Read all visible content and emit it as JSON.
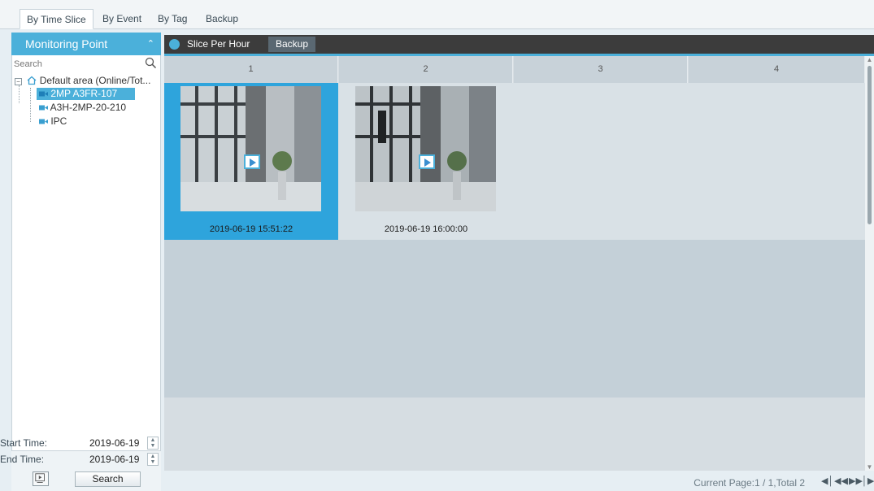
{
  "tabs": [
    {
      "label": "By Time Slice",
      "active": true
    },
    {
      "label": "By Event",
      "active": false
    },
    {
      "label": "By Tag",
      "active": false
    },
    {
      "label": "Backup",
      "active": false
    }
  ],
  "left_panel": {
    "title": "Monitoring Point",
    "search_placeholder": "Search",
    "tree": {
      "root_label": "Default area (Online/Tot...",
      "devices": [
        {
          "label": "2MP A3FR-107",
          "selected": true
        },
        {
          "label": "A3H-2MP-20-210",
          "selected": false
        },
        {
          "label": "IPC",
          "selected": false
        }
      ]
    },
    "start_time_label": "Start Time:",
    "start_time_value": "2019-06-19",
    "end_time_label": "End Time:",
    "end_time_value": "2019-06-19",
    "search_button": "Search"
  },
  "toolbar": {
    "slice_label": "Slice Per Hour",
    "backup_label": "Backup"
  },
  "grid": {
    "columns": [
      "1",
      "2",
      "3",
      "4"
    ],
    "slices": [
      {
        "time": "2019-06-19 15:51:22",
        "selected": true
      },
      {
        "time": "2019-06-19 16:00:00",
        "selected": false
      }
    ]
  },
  "status": {
    "page_text": "Current Page:1 / 1,Total 2"
  },
  "colors": {
    "accent": "#4bb0da",
    "selected_slice": "#2ea4dc",
    "toolbar_bg": "#3c3c3c"
  },
  "icons": [
    "search-icon",
    "home-icon",
    "camera-icon",
    "back-icon",
    "play-icon",
    "first-page-icon",
    "prev-page-icon",
    "next-page-icon",
    "last-page-icon"
  ]
}
